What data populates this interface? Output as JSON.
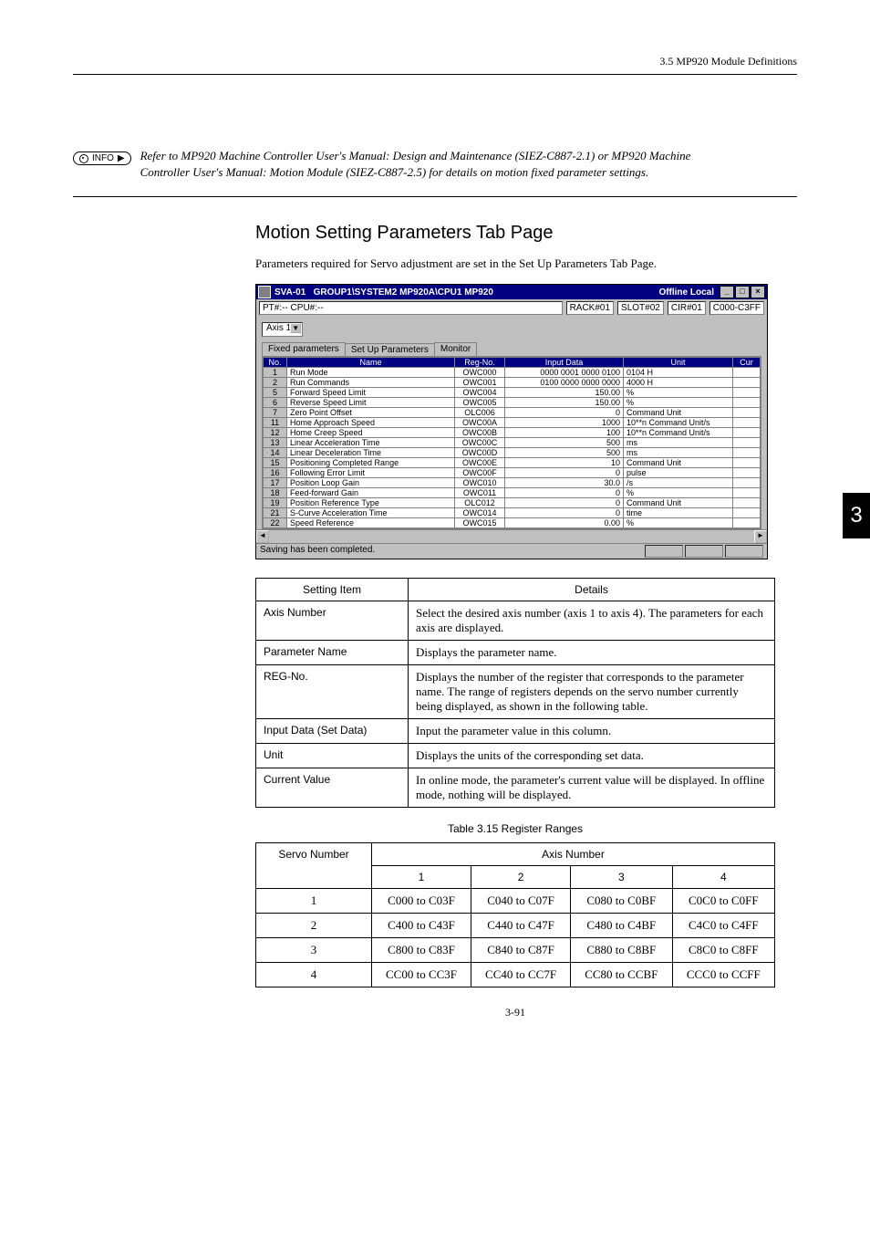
{
  "header": {
    "section": "3.5 MP920 Module Definitions"
  },
  "info": {
    "badge": "INFO",
    "prefix": "Refer to ",
    "text": "MP920 Machine Controller User's Manual: Design and Maintenance (SIEZ-C887-2.1) or MP920 Machine Controller User's Manual: Motion Module (SIEZ-C887-2.5) for details on motion fixed parameter settings."
  },
  "section": {
    "title": "Motion Setting Parameters Tab Page",
    "lead": "Parameters required for Servo adjustment are set in the Set Up Parameters Tab Page."
  },
  "chapter": "3",
  "footer": "3-91",
  "win": {
    "app": "SVA-01",
    "path": "GROUP1\\SYSTEM2  MP920A\\CPU1  MP920",
    "mode": "Offline  Local",
    "btn_min": "_",
    "btn_max": "□",
    "btn_close": "×",
    "pt": "PT#:--  CPU#:--",
    "rack": "RACK#01",
    "slot": "SLOT#02",
    "cir": "CIR#01",
    "range": "C000-C3FF",
    "axis": "Axis 1",
    "tabs": {
      "fixed": "Fixed parameters",
      "setup": "Set Up Parameters",
      "monitor": "Monitor"
    },
    "cols": {
      "no": "No.",
      "name": "Name",
      "reg": "Reg-No.",
      "input": "Input Data",
      "unit": "Unit",
      "cur": "Cur"
    },
    "rows": [
      {
        "no": "1",
        "name": "Run Mode",
        "reg": "OWC000",
        "input": "0000 0001 0000 0100",
        "unit": "0104 H"
      },
      {
        "no": "2",
        "name": "Run Commands",
        "reg": "OWC001",
        "input": "0100 0000 0000 0000",
        "unit": "4000 H"
      },
      {
        "no": "5",
        "name": "Forward Speed Limit",
        "reg": "OWC004",
        "input": "150.00",
        "unit": "%"
      },
      {
        "no": "6",
        "name": "Reverse Speed Limit",
        "reg": "OWC005",
        "input": "150.00",
        "unit": "%"
      },
      {
        "no": "7",
        "name": "Zero Point Offset",
        "reg": "OLC006",
        "input": "0",
        "unit": "Command Unit"
      },
      {
        "no": "11",
        "name": "Home Approach Speed",
        "reg": "OWC00A",
        "input": "1000",
        "unit": "10**n Command Unit/s"
      },
      {
        "no": "12",
        "name": "Home Creep Speed",
        "reg": "OWC00B",
        "input": "100",
        "unit": "10**n Command Unit/s"
      },
      {
        "no": "13",
        "name": "Linear Acceleration Time",
        "reg": "OWC00C",
        "input": "500",
        "unit": "ms"
      },
      {
        "no": "14",
        "name": "Linear Deceleration Time",
        "reg": "OWC00D",
        "input": "500",
        "unit": "ms"
      },
      {
        "no": "15",
        "name": "Positioning Completed Range",
        "reg": "OWC00E",
        "input": "10",
        "unit": "Command Unit"
      },
      {
        "no": "16",
        "name": "Following Error Limit",
        "reg": "OWC00F",
        "input": "0",
        "unit": "pulse"
      },
      {
        "no": "17",
        "name": "Position Loop Gain",
        "reg": "OWC010",
        "input": "30.0",
        "unit": "/s"
      },
      {
        "no": "18",
        "name": "Feed-forward Gain",
        "reg": "OWC011",
        "input": "0",
        "unit": "%"
      },
      {
        "no": "19",
        "name": "Position Reference Type",
        "reg": "OLC012",
        "input": "0",
        "unit": "Command Unit"
      },
      {
        "no": "21",
        "name": "S-Curve Acceleration Time",
        "reg": "OWC014",
        "input": "0",
        "unit": "time"
      },
      {
        "no": "22",
        "name": "Speed Reference",
        "reg": "OWC015",
        "input": "0.00",
        "unit": "%"
      }
    ],
    "status": "Saving has been completed."
  },
  "details": {
    "head": {
      "item": "Setting Item",
      "details": "Details"
    },
    "rows": [
      {
        "item": "Axis Number",
        "details": "Select the desired axis number (axis 1 to axis 4). The parameters for each axis are displayed."
      },
      {
        "item": "Parameter Name",
        "details": "Displays the parameter name."
      },
      {
        "item": "REG-No.",
        "details": "Displays the number of the register that corresponds to the parameter name. The range of registers depends on the servo number currently being displayed, as shown in the following table."
      },
      {
        "item": "Input Data (Set Data)",
        "details": "Input the parameter value in this column."
      },
      {
        "item": "Unit",
        "details": "Displays the units of the corresponding set data."
      },
      {
        "item": "Current Value",
        "details": "In online mode, the parameter's current value will be displayed. In offline mode, nothing will be displayed."
      }
    ]
  },
  "ranges": {
    "caption": "Table 3.15  Register Ranges",
    "head": {
      "servo": "Servo Number",
      "axis": "Axis Number",
      "a1": "1",
      "a2": "2",
      "a3": "3",
      "a4": "4"
    },
    "rows": [
      {
        "s": "1",
        "c": [
          "C000 to C03F",
          "C040 to C07F",
          "C080 to C0BF",
          "C0C0 to C0FF"
        ]
      },
      {
        "s": "2",
        "c": [
          "C400 to C43F",
          "C440 to C47F",
          "C480 to C4BF",
          "C4C0 to C4FF"
        ]
      },
      {
        "s": "3",
        "c": [
          "C800 to C83F",
          "C840 to C87F",
          "C880 to C8BF",
          "C8C0 to C8FF"
        ]
      },
      {
        "s": "4",
        "c": [
          "CC00 to CC3F",
          "CC40 to CC7F",
          "CC80 to CCBF",
          "CCC0 to CCFF"
        ]
      }
    ]
  }
}
